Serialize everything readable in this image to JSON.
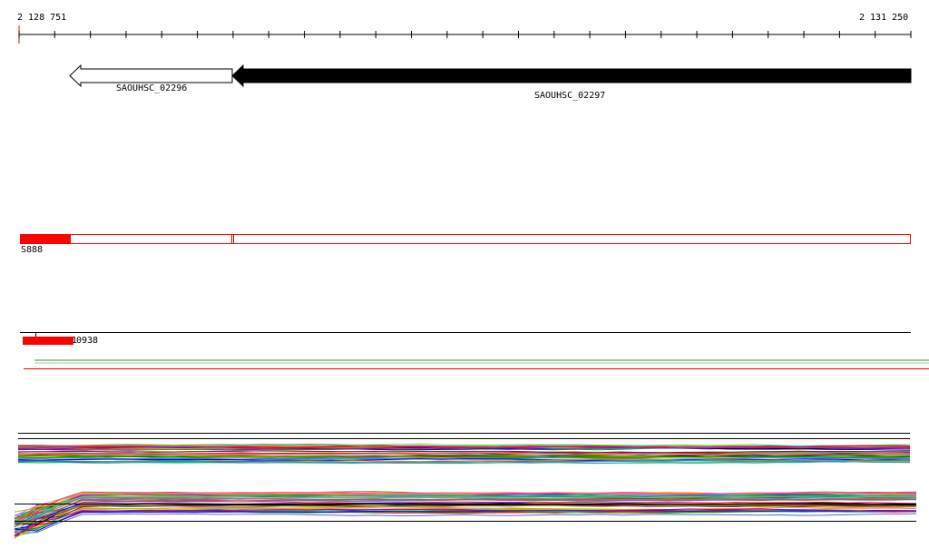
{
  "ruler": {
    "start_label": "2 128 751",
    "end_label": "2 131 250"
  },
  "genes": [
    {
      "name": "SAOUHSC_02296",
      "strand": "-",
      "style": "outline"
    },
    {
      "name": "SAOUHSC_02297",
      "strand": "-",
      "style": "filled"
    }
  ],
  "features": {
    "region_label": "S888",
    "small_label": "0938",
    "small_marker": "1"
  },
  "colors": {
    "accent": "#ff0000",
    "gene_fill": "#000000",
    "track_line_green": "#339933"
  }
}
